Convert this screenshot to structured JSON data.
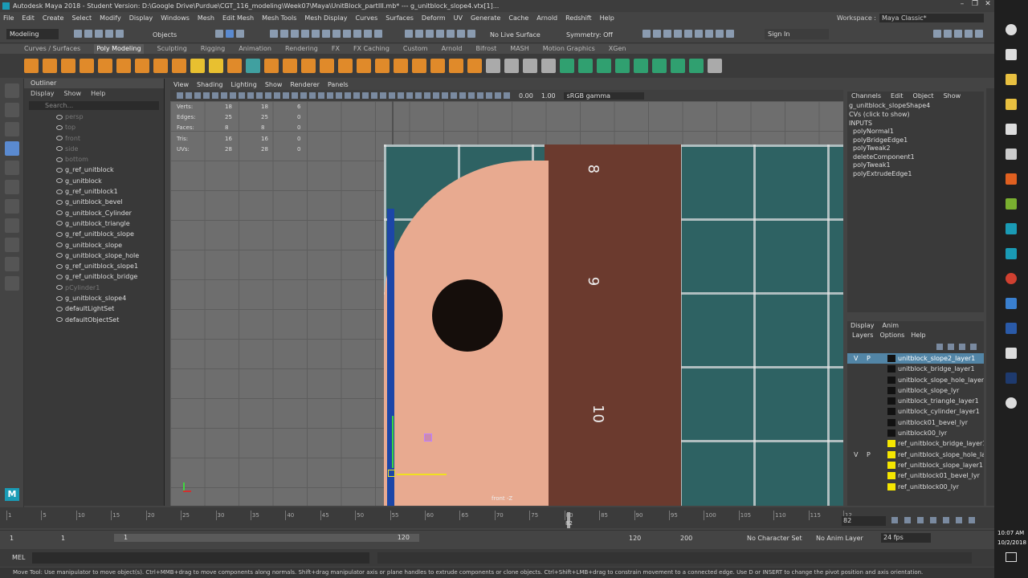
{
  "title": "Autodesk Maya 2018 - Student Version: D:\\Google Drive\\Purdue\\CGT_116_modeling\\Week07\\Maya\\UnitBlock_partIII.mb* --- g_unitblock_slope4.vtx[1]...",
  "menus": [
    "File",
    "Edit",
    "Create",
    "Select",
    "Modify",
    "Display",
    "Windows",
    "Mesh",
    "Edit Mesh",
    "Mesh Tools",
    "Mesh Display",
    "Curves",
    "Surfaces",
    "Deform",
    "UV",
    "Generate",
    "Cache",
    "Arnold",
    "Redshift",
    "Help"
  ],
  "workspace": {
    "label": "Workspace :",
    "value": "Maya Classic*"
  },
  "status": {
    "mode": "Modeling",
    "objects": "Objects",
    "live": "No Live Surface",
    "symmetry": "Symmetry: Off",
    "signin": "Sign In"
  },
  "shelf_tabs": [
    "Curves / Surfaces",
    "Poly Modeling",
    "Sculpting",
    "Rigging",
    "Animation",
    "Rendering",
    "FX",
    "FX Caching",
    "Custom",
    "Arnold",
    "Bifrost",
    "MASH",
    "Motion Graphics",
    "XGen"
  ],
  "active_shelf": "Poly Modeling",
  "outliner": {
    "tab": "Outliner",
    "menus": [
      "Display",
      "Show",
      "Help"
    ],
    "search": "Search...",
    "items": [
      {
        "n": "persp",
        "dim": true
      },
      {
        "n": "top",
        "dim": true
      },
      {
        "n": "front",
        "dim": true
      },
      {
        "n": "side",
        "dim": true
      },
      {
        "n": "bottom",
        "dim": true
      },
      {
        "n": "g_ref_unitblock"
      },
      {
        "n": "g_unitblock"
      },
      {
        "n": "g_ref_unitblock1"
      },
      {
        "n": "g_unitblock_bevel"
      },
      {
        "n": "g_unitblock_Cylinder"
      },
      {
        "n": "g_unitblock_triangle"
      },
      {
        "n": "g_ref_unitblock_slope"
      },
      {
        "n": "g_unitblock_slope"
      },
      {
        "n": "g_unitblock_slope_hole"
      },
      {
        "n": "g_ref_unitblock_slope1"
      },
      {
        "n": "g_ref_unitblock_bridge"
      },
      {
        "n": "pCylinder1",
        "dim": true
      },
      {
        "n": "g_unitblock_slope4"
      },
      {
        "n": "defaultLightSet"
      },
      {
        "n": "defaultObjectSet"
      }
    ]
  },
  "viewport": {
    "menus": [
      "View",
      "Shading",
      "Lighting",
      "Show",
      "Renderer",
      "Panels"
    ],
    "exposure": "0.00",
    "gamma": "1.00",
    "colorspace": "sRGB gamma",
    "camera": "front -Z",
    "hud": [
      [
        "Verts:",
        "18",
        "18",
        "6"
      ],
      [
        "Edges:",
        "25",
        "25",
        "0"
      ],
      [
        "Faces:",
        "8",
        "8",
        "0"
      ],
      [
        "Tris:",
        "16",
        "16",
        "0"
      ],
      [
        "UVs:",
        "28",
        "28",
        "0"
      ]
    ]
  },
  "channels": {
    "menus": [
      "Channels",
      "Edit",
      "Object",
      "Show"
    ],
    "shape": "g_unitblock_slopeShape4",
    "cvs": "CVs (click to show)",
    "inputs_label": "INPUTS",
    "inputs": [
      "polyNormal1",
      "polyBridgeEdge1",
      "polyTweak2",
      "deleteComponent1",
      "polyTweak1",
      "polyExtrudeEdge1"
    ]
  },
  "layers": {
    "tabs": [
      "Display",
      "Anim"
    ],
    "menus": [
      "Layers",
      "Options",
      "Help"
    ],
    "rows": [
      {
        "n": "unitblock_slope2_layer1",
        "sel": true,
        "v": "V",
        "p": "P",
        "c": "#111111"
      },
      {
        "n": "unitblock_bridge_layer1",
        "c": "#111111"
      },
      {
        "n": "unitblock_slope_hole_layer1",
        "c": "#111111"
      },
      {
        "n": "unitblock_slope_lyr",
        "c": "#111111"
      },
      {
        "n": "unitblock_triangle_layer1",
        "c": "#111111"
      },
      {
        "n": "unitblock_cylinder_layer1",
        "c": "#111111"
      },
      {
        "n": "unitblock01_bevel_lyr",
        "c": "#111111"
      },
      {
        "n": "unitblock00_lyr",
        "c": "#111111"
      },
      {
        "n": "ref_unitblock_bridge_layer1",
        "c": "#f5e600"
      },
      {
        "n": "ref_unitblock_slope_hole_layer",
        "v": "V",
        "p": "P",
        "c": "#f5e600"
      },
      {
        "n": "ref_unitblock_slope_layer1",
        "c": "#f5e600"
      },
      {
        "n": "ref_unitblock01_bevel_lyr",
        "c": "#f5e600"
      },
      {
        "n": "ref_unitblock00_lyr",
        "c": "#f5e600"
      }
    ]
  },
  "timeline": {
    "ticks": [
      "1",
      "5",
      "10",
      "15",
      "20",
      "25",
      "30",
      "35",
      "40",
      "45",
      "50",
      "55",
      "60",
      "65",
      "70",
      "75",
      "80",
      "85",
      "90",
      "95",
      "100",
      "105",
      "110",
      "115",
      "12"
    ],
    "current": "82",
    "frame_field": "82"
  },
  "range": {
    "start": "1",
    "start2": "1",
    "slider_start": "1",
    "slider_end": "120",
    "end": "120",
    "end2": "200",
    "character": "No Character Set",
    "anim_layer": "No Anim Layer",
    "fps": "24 fps"
  },
  "cmd": {
    "lang": "MEL"
  },
  "help_line": "Move Tool: Use manipulator to move object(s). Ctrl+MMB+drag to move components along normals. Shift+drag manipulator axis or plane handles to extrude components or clone objects. Ctrl+Shift+LMB+drag to constrain movement to a connected edge. Use D or INSERT to change the pivot position and axis orientation.",
  "clock": {
    "time": "10:07 AM",
    "date": "10/2/2018"
  },
  "colors": {
    "accent": "#5285a6",
    "bg": "#444444",
    "ref_layer": "#f5e600"
  }
}
